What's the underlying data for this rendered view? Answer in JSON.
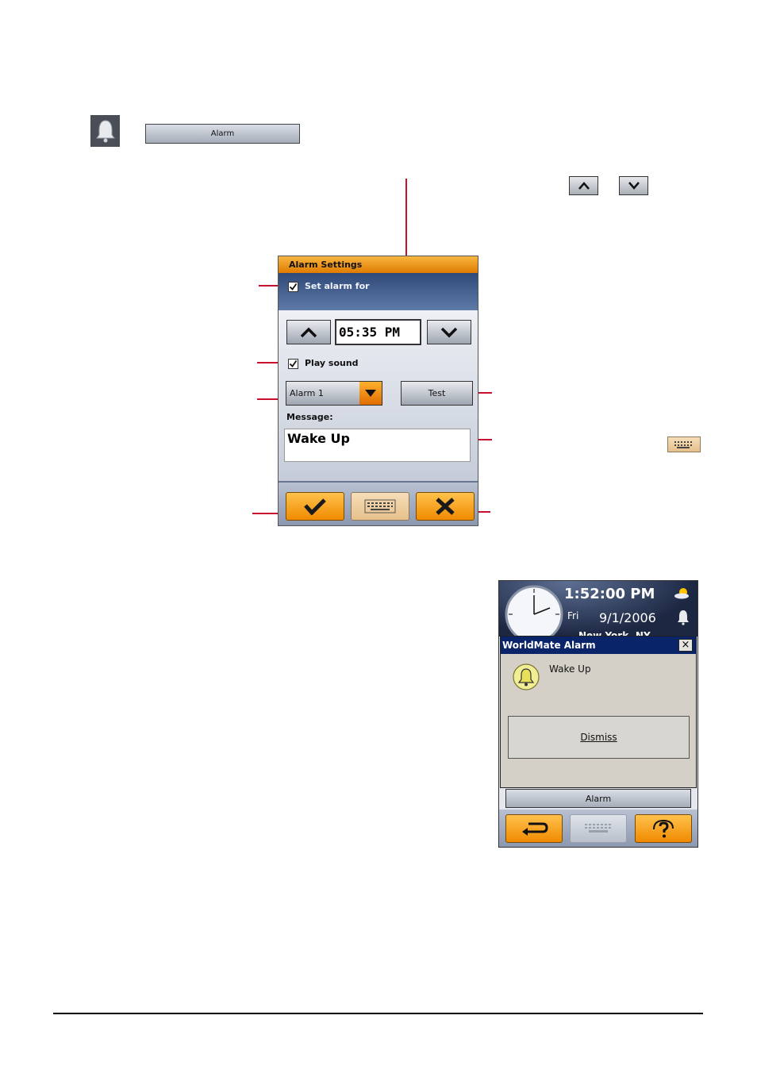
{
  "top": {
    "alarm_button_label": "Alarm"
  },
  "alarm_settings": {
    "title": "Alarm Settings",
    "set_alarm_label": "Set alarm for",
    "set_alarm_checked": true,
    "time_value": "05:35 PM",
    "play_sound_label": "Play sound",
    "play_sound_checked": true,
    "sound_selected": "Alarm 1",
    "test_label": "Test",
    "message_label": "Message:",
    "message_value": "Wake Up"
  },
  "worldmate": {
    "clock_time": "1:52:00 PM",
    "clock_day": "Fri",
    "clock_date": "9/1/2006",
    "city_partial": "New York, NY",
    "dialog_title": "WorldMate Alarm",
    "dialog_close": "×",
    "dialog_message": "Wake Up",
    "dismiss_label": "Dismiss",
    "alarm_button_label": "Alarm"
  },
  "colors": {
    "accent_orange": "#f08a00",
    "callout_red": "#c8102e",
    "title_blue": "#0a246a"
  }
}
